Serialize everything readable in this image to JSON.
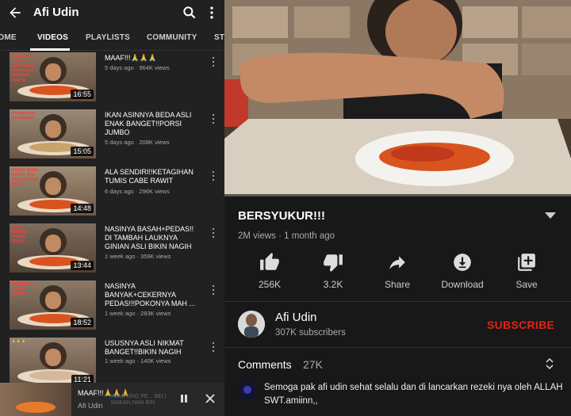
{
  "channel_page": {
    "title": "Afi Udin",
    "tabs": [
      {
        "label": "HOME"
      },
      {
        "label": "VIDEOS"
      },
      {
        "label": "PLAYLISTS"
      },
      {
        "label": "COMMUNITY"
      },
      {
        "label": "ST"
      }
    ],
    "active_tab": "VIDEOS",
    "videos": [
      {
        "title": "MAAF!!!🙏🙏🙏",
        "meta": "5 days ago · 964K views",
        "duration": "16:55",
        "caption": "setiap yang punya kekurangan pasti punya kelebihan masing²"
      },
      {
        "title": "IKAN ASINNYA BEDA ASLI ENAK BANGET!!PORSI JUMBO",
        "meta": "5 days ago · 208K views",
        "duration": "15:05",
        "caption": "nikmatnyaaa ini makanan"
      },
      {
        "title": "ALA SENDIRI!!KETAGIHAN TUMIS CABE RAWIT",
        "meta": "6 days ago · 296K views",
        "duration": "14:48",
        "caption": "MASAK RAKE MASAK ALA AFI UDIN ASLI BIKIN"
      },
      {
        "title": "NASINYA BASAH+PEDAS!! DI TAMBAH LAUKNYA GINIAN ASLI BIKIN NAGIH",
        "meta": "1 week ago · 359K views",
        "duration": "13:44",
        "caption": "BIKIN PENGEN MAKAN TERUS"
      },
      {
        "title": "NASINYA BANYAK+CEKERNYA PEDAS!!!POKONYA MAH ...",
        "meta": "1 week ago · 283K views",
        "duration": "18:52",
        "caption": "CEKERNYA JUMBO JUMBO"
      },
      {
        "title": "USUSNYA ASLI NIKMAT BANGET!!BIKIN NAGIH",
        "meta": "1 week ago · 140K views",
        "duration": "11:21",
        "caption": "🙏🙏🙏"
      }
    ],
    "mini_player": {
      "title": "MAAF!!!🙏🙏🙏",
      "channel": "Afi Udin",
      "overlay": "KAMPUNG PE... BELI MAKAN NAH BIN"
    }
  },
  "watch_page": {
    "video_title": "BERSYUKUR!!!",
    "views_line": "2M views · 1 month ago",
    "progress": 0.0,
    "actions": [
      {
        "label": "256K",
        "icon": "thumbs-up-icon"
      },
      {
        "label": "3.2K",
        "icon": "thumbs-down-icon"
      },
      {
        "label": "Share",
        "icon": "share-icon"
      },
      {
        "label": "Download",
        "icon": "download-icon"
      },
      {
        "label": "Save",
        "icon": "save-to-playlist-icon"
      }
    ],
    "channel_name": "Afi Udin",
    "subscribers": "307K subscribers",
    "subscribe_label": "SUBSCRIBE",
    "comments_label": "Comments",
    "comments_count": "27K",
    "top_comment": "Semoga pak afi udin sehat selalu dan di lancarkan rezeki nya oleh ALLAH SWT.amiinn,,"
  },
  "colors": {
    "subscribe": "#e62117",
    "progress": "#ff0000",
    "background": "#181818",
    "panel": "#212121"
  }
}
